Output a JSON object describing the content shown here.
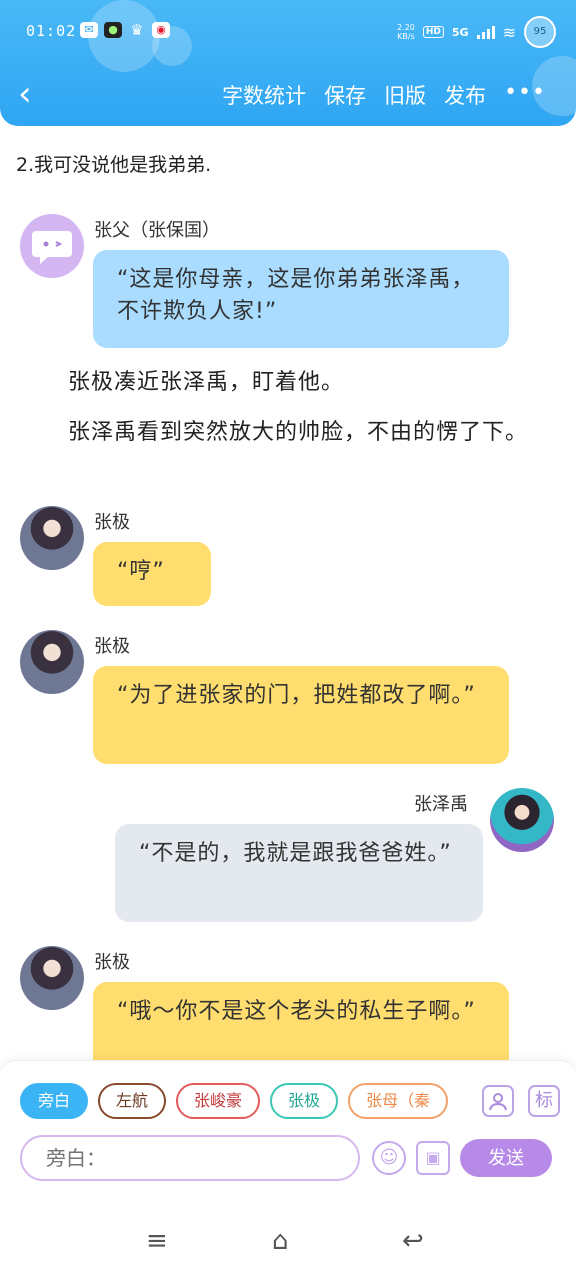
{
  "status_bar": {
    "time": "01:02",
    "speed_value": "2.20",
    "speed_unit": "KB/s",
    "hd": "HD",
    "network": "5G",
    "battery": "95"
  },
  "header": {
    "back_icon": "back-chevron-icon",
    "actions": [
      "字数统计",
      "保存",
      "旧版",
      "发布"
    ],
    "more_label": "•••"
  },
  "content": {
    "heading": "2.我可没说他是我弟弟.",
    "messages": [
      {
        "name": "张父（张保国）",
        "text": "“这是你母亲，这是你弟弟张泽禹，不许欺负人家!”"
      },
      {
        "name": "张极",
        "text": "“哼”"
      },
      {
        "name": "张极",
        "text": "“为了进张家的门，把姓都改了啊。”"
      },
      {
        "name": "张泽禹",
        "text": "“不是的，我就是跟我爸爸姓。”"
      },
      {
        "name": "张极",
        "text": "“哦～你不是这个老头的私生子啊。”"
      }
    ],
    "narration": [
      "张极凑近张泽禹，盯着他。",
      "张泽禹看到突然放大的帅脸，不由的愣了下。"
    ]
  },
  "input_panel": {
    "chips": [
      "旁白",
      "左航",
      "张峻豪",
      "张极",
      "张母（秦"
    ],
    "contacts_icon": "contact-icon",
    "tag_label": "标",
    "input_placeholder": "旁白：",
    "emoji_icon": "smiley-icon",
    "image_icon": "image-icon",
    "send_label": "发送"
  },
  "system_nav": {
    "menu_icon": "menu-icon",
    "home_icon": "home-icon",
    "back_icon": "return-icon"
  },
  "colors": {
    "header": "#2fa6f3",
    "bubble_blue": "#a9dcff",
    "bubble_yellow": "#ffdd6e",
    "bubble_gray": "#e4e8ef",
    "send": "#b78ae8"
  }
}
